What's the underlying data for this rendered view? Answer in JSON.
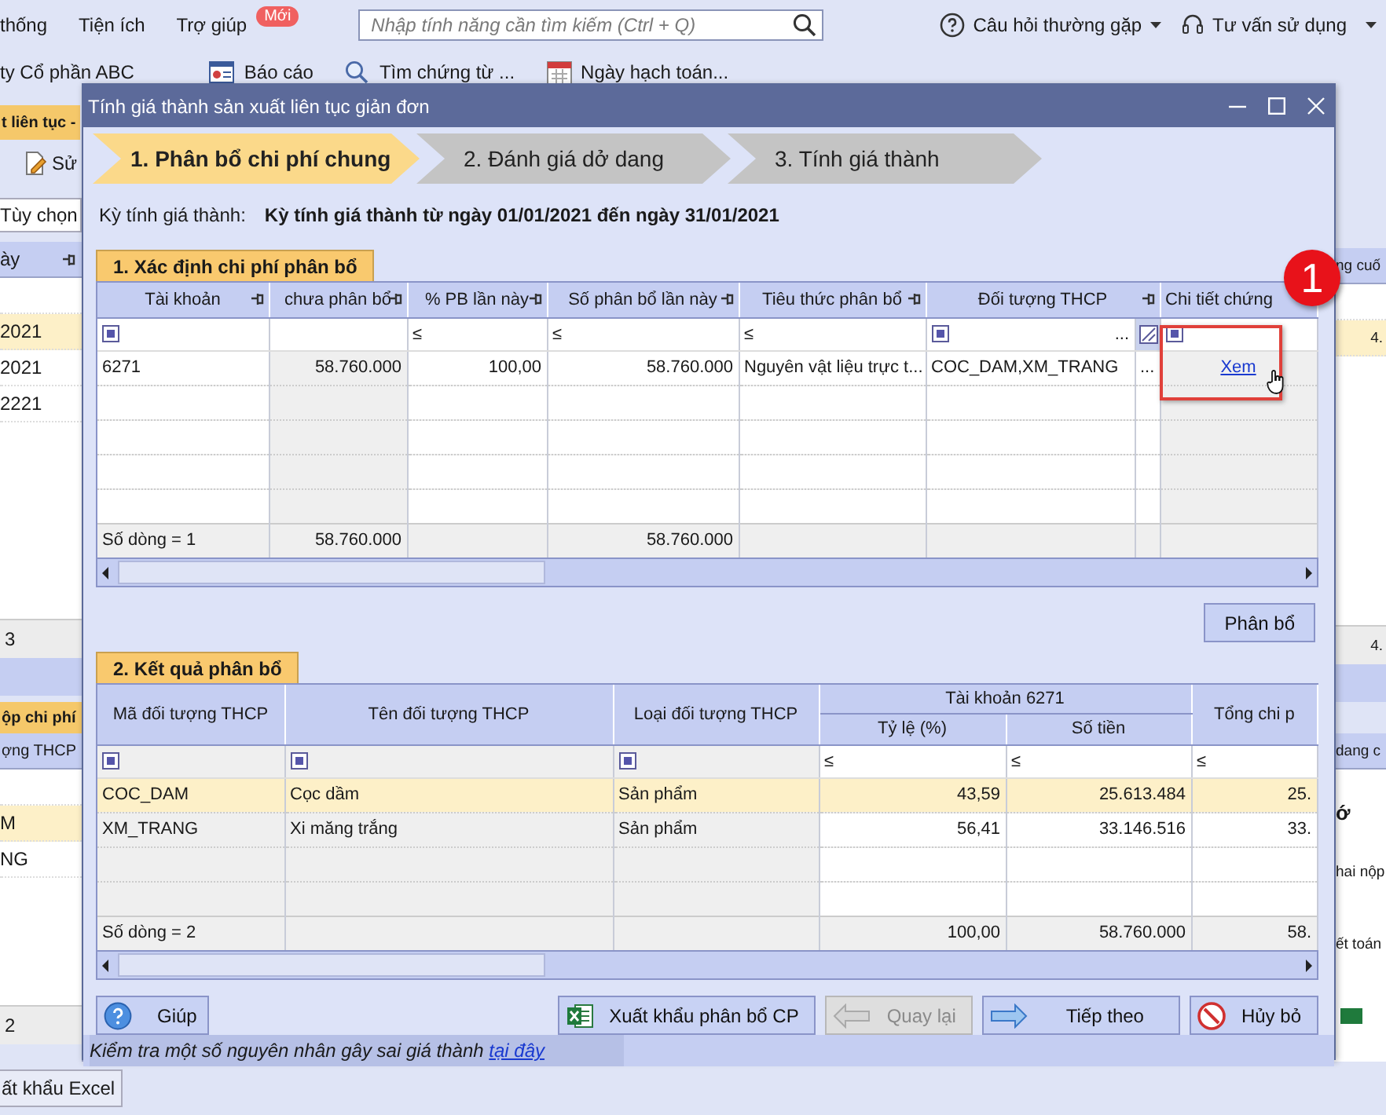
{
  "menu": {
    "items": [
      "thống",
      "Tiện ích",
      "Trợ giúp"
    ],
    "badge": "Mới",
    "search": {
      "placeholder": "Nhập tính năng cần tìm kiếm (Ctrl + Q)"
    },
    "help_links": [
      {
        "kind": "question",
        "label": "Câu hỏi thường gặp"
      },
      {
        "kind": "headset",
        "label": "Tư vấn sử dụng"
      }
    ]
  },
  "toolbar": [
    {
      "kind": "text",
      "label": "ty Cổ phần ABC"
    },
    {
      "kind": "report",
      "label": "Báo cáo"
    },
    {
      "kind": "search",
      "label": "Tìm chứng từ ..."
    },
    {
      "kind": "calendar",
      "label": "Ngày hạch toán..."
    }
  ],
  "background_left": {
    "tab": "t liên tục -",
    "button": "Sử",
    "field": "Tùy chọn",
    "grid1": {
      "header": "ày",
      "rows": [
        {
          "text": "2021",
          "selected": true
        },
        {
          "text": "2021",
          "selected": false
        },
        {
          "text": "2221",
          "selected": false
        }
      ],
      "total": "3"
    },
    "grid2": {
      "title": "ộp chi phí",
      "header": "ợng THCP",
      "rows": [
        {
          "text": "M",
          "selected": true
        },
        {
          "text": "NG",
          "selected": false
        }
      ],
      "total": "2"
    },
    "export_button": "ất khẩu Excel"
  },
  "background_right": {
    "grid1": {
      "header": "ng cuố",
      "rows": [
        {
          "text": "4.",
          "selected": true
        }
      ],
      "total": "4."
    },
    "grid2": {
      "header": "dang c"
    },
    "texts": [
      "ớ",
      "hai nộp",
      "ết toán"
    ]
  },
  "dialog": {
    "title": "Tính giá thành sản xuất liên tục giản đơn",
    "steps": [
      {
        "label": "1. Phân bổ chi phí chung",
        "selected": true
      },
      {
        "label": "2. Đánh giá dở dang",
        "selected": false
      },
      {
        "label": "3. Tính giá thành",
        "selected": false
      }
    ],
    "period": {
      "label": "Kỳ tính giá thành:",
      "value": "Kỳ tính giá thành từ ngày 01/01/2021 đến ngày 31/01/2021"
    },
    "allocation": {
      "title": "1. Xác định chi phí phân bổ",
      "columns": [
        "Tài khoản",
        "chưa phân bổ",
        "% PB lần này",
        "Số phân bổ lần này",
        "Tiêu thức phân bổ",
        "Đối tượng THCP",
        "Chi tiết chứng"
      ],
      "filters": [
        {
          "kind": "box"
        },
        {
          "kind": "none"
        },
        {
          "kind": "le",
          "text": "≤"
        },
        {
          "kind": "le",
          "text": "≤"
        },
        {
          "kind": "le",
          "text": "≤"
        },
        {
          "kind": "picker",
          "text": "..."
        },
        {
          "kind": "box"
        }
      ],
      "rows": [
        {
          "cells": [
            "6271",
            "58.760.000",
            "100,00",
            "58.760.000",
            "Nguyên vật liệu trực t...",
            "COC_DAM,XM_TRANG"
          ],
          "picker": "...",
          "link": "Xem"
        }
      ],
      "total": {
        "label": "Số dòng = 1",
        "unallocated": "58.760.000",
        "allocated": "58.760.000"
      },
      "callout": "1"
    },
    "allocate_button": "Phân bổ",
    "result": {
      "title": "2. Kết quả phân bổ",
      "group": "Tài khoản 6271",
      "columns": [
        "Mã đối tượng THCP",
        "Tên đối tượng THCP",
        "Loại đối tượng THCP",
        "Tỷ lệ (%)",
        "Số tiền",
        "Tổng chi p"
      ],
      "filters": [
        {
          "kind": "box"
        },
        {
          "kind": "box"
        },
        {
          "kind": "box"
        },
        {
          "kind": "le",
          "text": "≤"
        },
        {
          "kind": "le",
          "text": "≤"
        },
        {
          "kind": "le",
          "text": "≤"
        }
      ],
      "rows": [
        {
          "cells": [
            "COC_DAM",
            "Cọc dầm",
            "Sản phẩm",
            "43,59",
            "25.613.484",
            "25."
          ],
          "selected": true
        },
        {
          "cells": [
            "XM_TRANG",
            "Xi măng trắng",
            "Sản phẩm",
            "56,41",
            "33.146.516",
            "33."
          ],
          "selected": false
        }
      ],
      "total": {
        "label": "Số dòng = 2",
        "rate": "100,00",
        "amount": "58.760.000",
        "grand_total": "58."
      }
    },
    "buttons": [
      {
        "kind": "help",
        "label": "Giúp",
        "disabled": false
      },
      {
        "kind": "excel",
        "label": "Xuất khẩu phân bổ CP",
        "disabled": false
      },
      {
        "kind": "back",
        "label": "Quay lại",
        "disabled": true
      },
      {
        "kind": "next",
        "label": "Tiếp theo",
        "disabled": false
      },
      {
        "kind": "cancel",
        "label": "Hủy bỏ",
        "disabled": false
      }
    ],
    "status": {
      "text": "Kiểm tra một số nguyên nhân gây sai giá thành",
      "link": "tại đây"
    }
  }
}
